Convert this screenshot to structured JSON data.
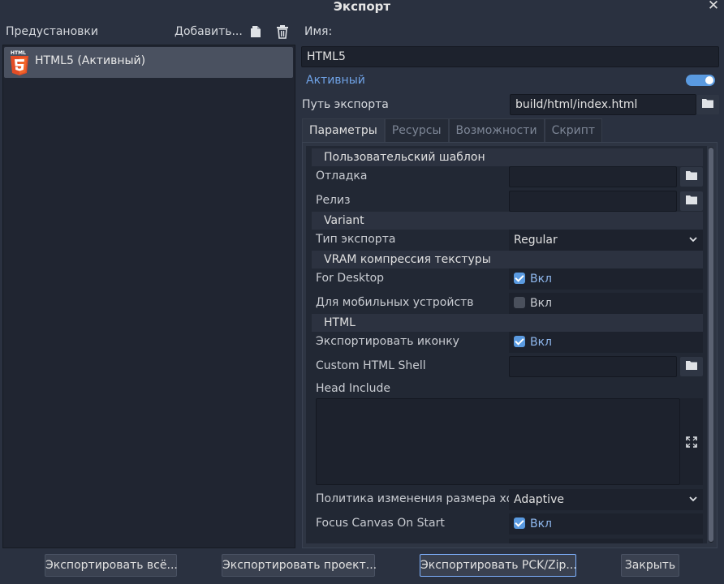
{
  "window": {
    "title": "Экспорт"
  },
  "presets": {
    "label": "Предустановки",
    "add_label": "Добавить...",
    "items": [
      {
        "label": "HTML5 (Активный)",
        "logo_text": "HTML"
      }
    ]
  },
  "details": {
    "name_label": "Имя:",
    "name_value": "HTML5",
    "active_label": "Активный",
    "active_on": true,
    "export_path_label": "Путь экспорта",
    "export_path_value": "build/html/index.html"
  },
  "tabs": [
    {
      "label": "Параметры",
      "active": true
    },
    {
      "label": "Ресурсы"
    },
    {
      "label": "Возможности"
    },
    {
      "label": "Скрипт"
    }
  ],
  "options": {
    "custom_template_section": "Пользовательский шаблон",
    "debug_label": "Отладка",
    "release_label": "Релиз",
    "variant_section": "Variant",
    "export_type_label": "Тип экспорта",
    "export_type_value": "Regular",
    "vram_section": "VRAM компрессия текстуры",
    "for_desktop_label": "For Desktop",
    "for_desktop_value": "Вкл",
    "for_desktop_checked": true,
    "for_mobile_label": "Для мобильных устройств",
    "for_mobile_value": "Вкл",
    "for_mobile_checked": false,
    "html_section": "HTML",
    "export_icon_label": "Экспортировать иконку",
    "export_icon_value": "Вкл",
    "export_icon_checked": true,
    "custom_shell_label": "Custom HTML Shell",
    "head_include_label": "Head Include",
    "resize_policy_label": "Политика изменения размера хо",
    "resize_policy_value": "Adaptive",
    "focus_canvas_label": "Focus Canvas On Start",
    "focus_canvas_value": "Вкл",
    "focus_canvas_checked": true
  },
  "buttons": {
    "export_all": "Экспортировать всё...",
    "export_project": "Экспортировать проект...",
    "export_pck": "Экспортировать PCK/Zip...",
    "close": "Закрыть"
  },
  "colors": {
    "accent": "#5a9ae0",
    "active_text": "#6fa2e6",
    "background": "#2a3140"
  },
  "icons": [
    "close-icon",
    "duplicate-icon",
    "trash-icon",
    "folder-icon",
    "html5-icon",
    "chevron-down-icon",
    "expand-icon",
    "checkbox-icon"
  ]
}
